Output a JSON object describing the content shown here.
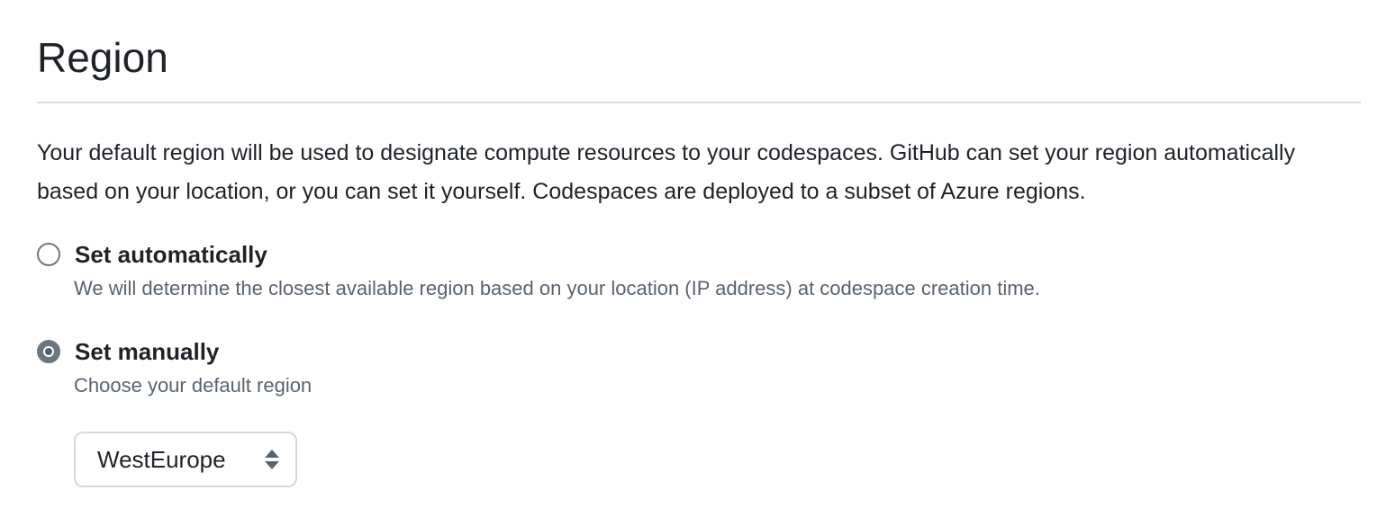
{
  "section": {
    "title": "Region",
    "description": "Your default region will be used to designate compute resources to your codespaces. GitHub can set your region automatically based on your location, or you can set it yourself. Codespaces are deployed to a subset of Azure regions."
  },
  "options": {
    "automatic": {
      "label": "Set automatically",
      "note": "We will determine the closest available region based on your location (IP address) at codespace creation time.",
      "selected": false
    },
    "manual": {
      "label": "Set manually",
      "note": "Choose your default region",
      "selected": true
    }
  },
  "region_select": {
    "value": "WestEurope",
    "icon": "select-arrows-icon"
  },
  "colors": {
    "text": "#1f2328",
    "muted_text": "#59636e",
    "divider": "#d8dee4",
    "radio": "#6e7781",
    "select_border": "#d1d9e0"
  }
}
